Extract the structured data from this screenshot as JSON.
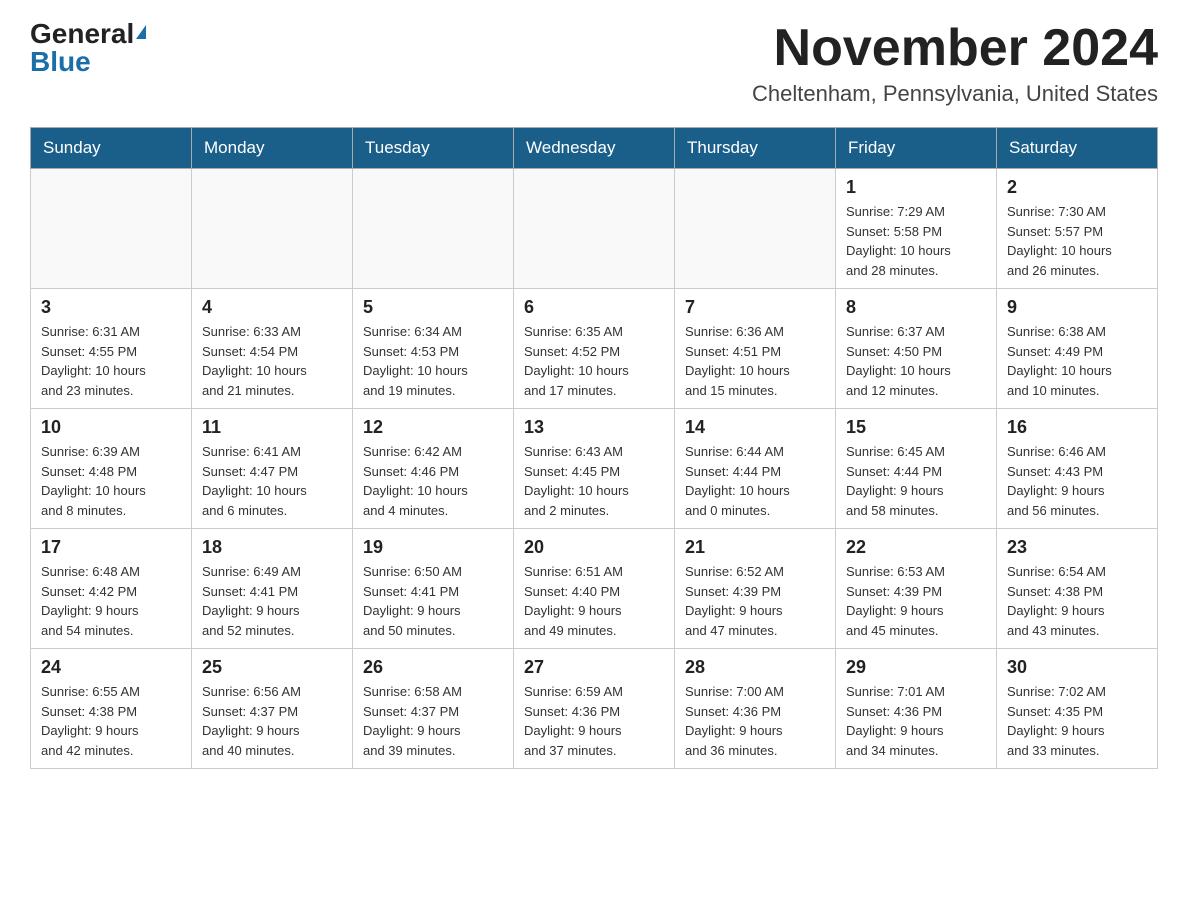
{
  "header": {
    "logo_general": "General",
    "logo_blue": "Blue",
    "month_title": "November 2024",
    "location": "Cheltenham, Pennsylvania, United States"
  },
  "weekdays": [
    "Sunday",
    "Monday",
    "Tuesday",
    "Wednesday",
    "Thursday",
    "Friday",
    "Saturday"
  ],
  "weeks": [
    [
      {
        "day": "",
        "info": ""
      },
      {
        "day": "",
        "info": ""
      },
      {
        "day": "",
        "info": ""
      },
      {
        "day": "",
        "info": ""
      },
      {
        "day": "",
        "info": ""
      },
      {
        "day": "1",
        "info": "Sunrise: 7:29 AM\nSunset: 5:58 PM\nDaylight: 10 hours\nand 28 minutes."
      },
      {
        "day": "2",
        "info": "Sunrise: 7:30 AM\nSunset: 5:57 PM\nDaylight: 10 hours\nand 26 minutes."
      }
    ],
    [
      {
        "day": "3",
        "info": "Sunrise: 6:31 AM\nSunset: 4:55 PM\nDaylight: 10 hours\nand 23 minutes."
      },
      {
        "day": "4",
        "info": "Sunrise: 6:33 AM\nSunset: 4:54 PM\nDaylight: 10 hours\nand 21 minutes."
      },
      {
        "day": "5",
        "info": "Sunrise: 6:34 AM\nSunset: 4:53 PM\nDaylight: 10 hours\nand 19 minutes."
      },
      {
        "day": "6",
        "info": "Sunrise: 6:35 AM\nSunset: 4:52 PM\nDaylight: 10 hours\nand 17 minutes."
      },
      {
        "day": "7",
        "info": "Sunrise: 6:36 AM\nSunset: 4:51 PM\nDaylight: 10 hours\nand 15 minutes."
      },
      {
        "day": "8",
        "info": "Sunrise: 6:37 AM\nSunset: 4:50 PM\nDaylight: 10 hours\nand 12 minutes."
      },
      {
        "day": "9",
        "info": "Sunrise: 6:38 AM\nSunset: 4:49 PM\nDaylight: 10 hours\nand 10 minutes."
      }
    ],
    [
      {
        "day": "10",
        "info": "Sunrise: 6:39 AM\nSunset: 4:48 PM\nDaylight: 10 hours\nand 8 minutes."
      },
      {
        "day": "11",
        "info": "Sunrise: 6:41 AM\nSunset: 4:47 PM\nDaylight: 10 hours\nand 6 minutes."
      },
      {
        "day": "12",
        "info": "Sunrise: 6:42 AM\nSunset: 4:46 PM\nDaylight: 10 hours\nand 4 minutes."
      },
      {
        "day": "13",
        "info": "Sunrise: 6:43 AM\nSunset: 4:45 PM\nDaylight: 10 hours\nand 2 minutes."
      },
      {
        "day": "14",
        "info": "Sunrise: 6:44 AM\nSunset: 4:44 PM\nDaylight: 10 hours\nand 0 minutes."
      },
      {
        "day": "15",
        "info": "Sunrise: 6:45 AM\nSunset: 4:44 PM\nDaylight: 9 hours\nand 58 minutes."
      },
      {
        "day": "16",
        "info": "Sunrise: 6:46 AM\nSunset: 4:43 PM\nDaylight: 9 hours\nand 56 minutes."
      }
    ],
    [
      {
        "day": "17",
        "info": "Sunrise: 6:48 AM\nSunset: 4:42 PM\nDaylight: 9 hours\nand 54 minutes."
      },
      {
        "day": "18",
        "info": "Sunrise: 6:49 AM\nSunset: 4:41 PM\nDaylight: 9 hours\nand 52 minutes."
      },
      {
        "day": "19",
        "info": "Sunrise: 6:50 AM\nSunset: 4:41 PM\nDaylight: 9 hours\nand 50 minutes."
      },
      {
        "day": "20",
        "info": "Sunrise: 6:51 AM\nSunset: 4:40 PM\nDaylight: 9 hours\nand 49 minutes."
      },
      {
        "day": "21",
        "info": "Sunrise: 6:52 AM\nSunset: 4:39 PM\nDaylight: 9 hours\nand 47 minutes."
      },
      {
        "day": "22",
        "info": "Sunrise: 6:53 AM\nSunset: 4:39 PM\nDaylight: 9 hours\nand 45 minutes."
      },
      {
        "day": "23",
        "info": "Sunrise: 6:54 AM\nSunset: 4:38 PM\nDaylight: 9 hours\nand 43 minutes."
      }
    ],
    [
      {
        "day": "24",
        "info": "Sunrise: 6:55 AM\nSunset: 4:38 PM\nDaylight: 9 hours\nand 42 minutes."
      },
      {
        "day": "25",
        "info": "Sunrise: 6:56 AM\nSunset: 4:37 PM\nDaylight: 9 hours\nand 40 minutes."
      },
      {
        "day": "26",
        "info": "Sunrise: 6:58 AM\nSunset: 4:37 PM\nDaylight: 9 hours\nand 39 minutes."
      },
      {
        "day": "27",
        "info": "Sunrise: 6:59 AM\nSunset: 4:36 PM\nDaylight: 9 hours\nand 37 minutes."
      },
      {
        "day": "28",
        "info": "Sunrise: 7:00 AM\nSunset: 4:36 PM\nDaylight: 9 hours\nand 36 minutes."
      },
      {
        "day": "29",
        "info": "Sunrise: 7:01 AM\nSunset: 4:36 PM\nDaylight: 9 hours\nand 34 minutes."
      },
      {
        "day": "30",
        "info": "Sunrise: 7:02 AM\nSunset: 4:35 PM\nDaylight: 9 hours\nand 33 minutes."
      }
    ]
  ]
}
